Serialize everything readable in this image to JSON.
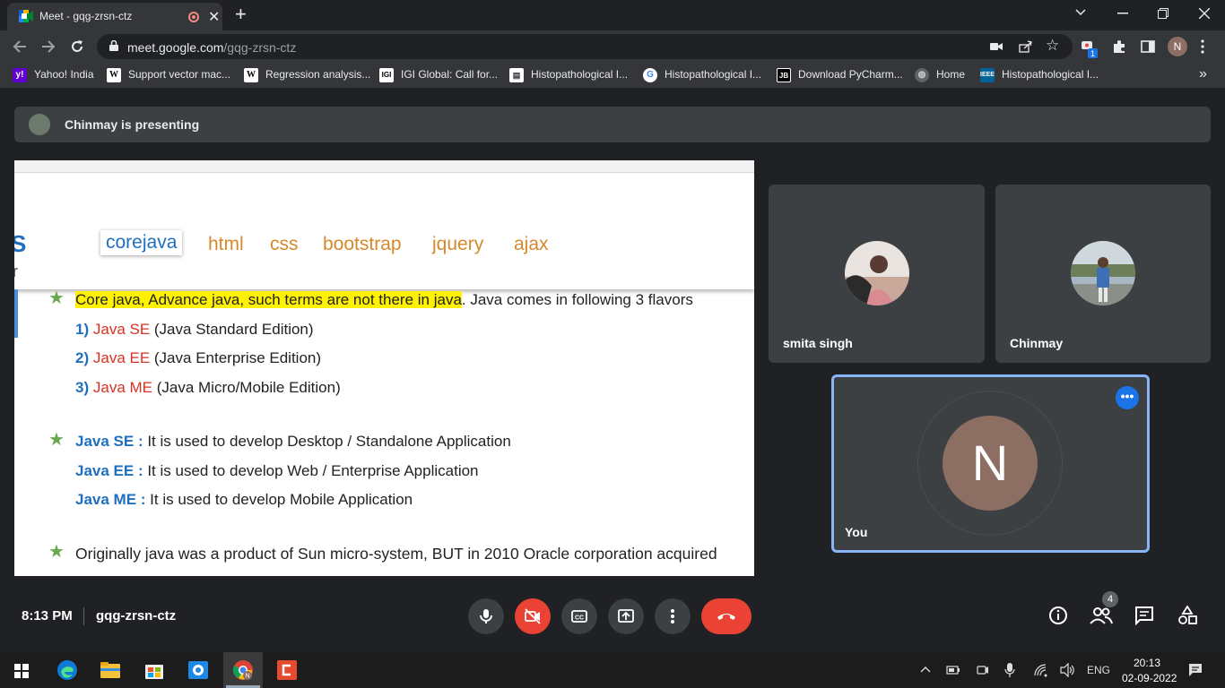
{
  "browser": {
    "tab_title": "Meet - gqg-zrsn-ctz",
    "url_host": "meet.google.com",
    "url_path": "/gqg-zrsn-ctz",
    "extension_badge": "1",
    "profile_initial": "N"
  },
  "bookmarks": [
    {
      "label": "Yahoo! India",
      "icon": "yahoo-icon",
      "color": "#6001d2"
    },
    {
      "label": "Support vector mac...",
      "icon": "wikipedia-icon",
      "color": "#ffffff"
    },
    {
      "label": "Regression analysis...",
      "icon": "wikipedia-icon",
      "color": "#ffffff"
    },
    {
      "label": "IGI Global: Call for...",
      "icon": "igi-icon",
      "color": "#ffffff"
    },
    {
      "label": "Histopathological I...",
      "icon": "doc-icon",
      "color": "#ffffff"
    },
    {
      "label": "Histopathological I...",
      "icon": "google-icon",
      "color": "#ffffff"
    },
    {
      "label": "Download PyCharm...",
      "icon": "jetbrains-icon",
      "color": "#000000"
    },
    {
      "label": "Home",
      "icon": "globe-icon",
      "color": "#5f6368"
    },
    {
      "label": "Histopathological I...",
      "icon": "ieee-icon",
      "color": "#00629b"
    }
  ],
  "meet": {
    "presenting_text": "Chinmay is presenting",
    "slide": {
      "logo_fragment": "S",
      "logo_fragment2": "r",
      "menu": [
        "corejava",
        "html",
        "css",
        "bootstrap",
        "jquery",
        "ajax"
      ],
      "line1_highlight": "Core java, Advance java, such terms are not there in java",
      "line1_rest": ". Java comes in following 3 flavors",
      "flavors": [
        {
          "num": "1)",
          "name": "Java SE",
          "desc": " (Java Standard Edition)"
        },
        {
          "num": "2)",
          "name": "Java EE",
          "desc": " (Java Enterprise Edition)"
        },
        {
          "num": "3)",
          "name": "Java ME",
          "desc": " (Java Micro/Mobile Edition)"
        }
      ],
      "uses": [
        {
          "name": "Java SE :",
          "desc": " It is used to develop Desktop / Standalone Application"
        },
        {
          "name": "Java EE :",
          "desc": " It is used to develop Web / Enterprise Application"
        },
        {
          "name": "Java ME :",
          "desc": " It is used to develop Mobile Application"
        }
      ],
      "last_line": "Originally java was a product of Sun micro-system, BUT in 2010 Oracle corporation acquired"
    },
    "participants": [
      {
        "name": "smita singh"
      },
      {
        "name": "Chinmay"
      }
    ],
    "self": {
      "name": "You",
      "initial": "N"
    },
    "time": "8:13 PM",
    "meeting_code": "gqg-zrsn-ctz",
    "people_count": "4"
  },
  "taskbar": {
    "lang": "ENG",
    "time": "20:13",
    "date": "02-09-2022"
  }
}
